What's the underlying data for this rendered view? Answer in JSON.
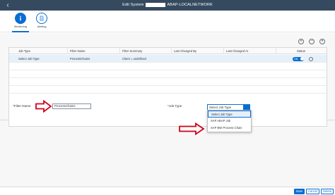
{
  "window": {
    "title_prefix": "Edit System",
    "title_suffix": "ABAP-LOCALNETWORK"
  },
  "tabs": [
    {
      "label": "Monitoring",
      "icon": "info-icon",
      "active": true
    },
    {
      "label": "Alerting",
      "icon": "alert-icon",
      "active": false
    }
  ],
  "toolbar": {
    "icons": [
      "add-icon",
      "remove-icon",
      "settings-icon"
    ]
  },
  "table": {
    "columns": [
      "Job Type",
      "Filter Name",
      "Filter Summary",
      "Last Changed By",
      "Last Changed At",
      "Status"
    ],
    "rows": [
      {
        "job_type": "Select Job Type",
        "filter_name": "ProcessChains",
        "filter_summary": "Client = undefined",
        "last_changed_by": "",
        "last_changed_at": "",
        "status_label": "ON",
        "status_on": true
      }
    ]
  },
  "form": {
    "filter_name_label": "*Filter Name",
    "filter_name_value": "ProcessChains",
    "job_type_label": "*Job Type",
    "job_type_selected": "Select Job Type",
    "job_type_options": [
      "Select Job Type",
      "SAP ABAP Job",
      "SAP BW Process Chain"
    ]
  },
  "footer": {
    "save_label": "Save",
    "cancel_label": "Cancel",
    "delete_label": "Delete"
  },
  "colors": {
    "shell": "#354a5f",
    "accent": "#0a6ed1",
    "selection": "#e5f0fa",
    "annotation_arrow": "#d0021b"
  }
}
